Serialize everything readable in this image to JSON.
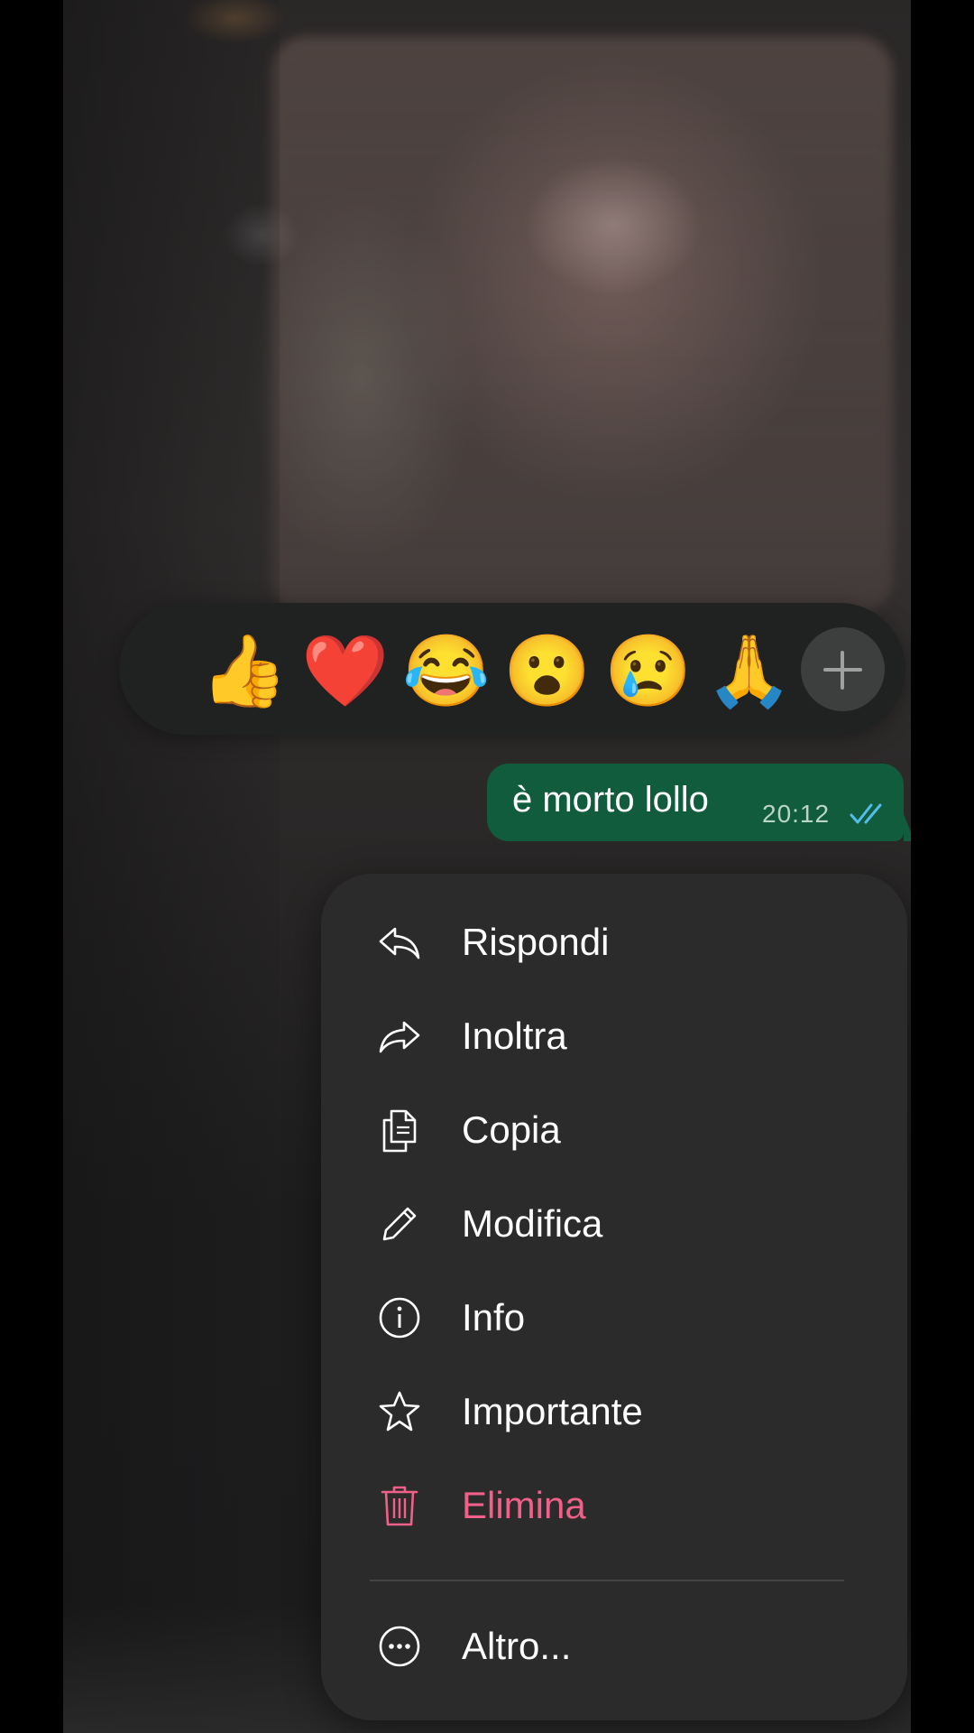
{
  "reactions": {
    "emojis": [
      "👍",
      "❤️",
      "😂",
      "😮",
      "😢",
      "🙏"
    ],
    "more_icon": "plus-icon"
  },
  "message": {
    "text": "è morto lollo",
    "time": "20:12",
    "status_icon": "double-check-icon",
    "bubble_color": "#105c3d",
    "tick_color": "#53bdeb"
  },
  "menu": {
    "items": [
      {
        "label": "Rispondi",
        "icon": "reply-icon"
      },
      {
        "label": "Inoltra",
        "icon": "forward-icon"
      },
      {
        "label": "Copia",
        "icon": "copy-icon"
      },
      {
        "label": "Modifica",
        "icon": "pencil-icon"
      },
      {
        "label": "Info",
        "icon": "info-icon"
      },
      {
        "label": "Importante",
        "icon": "star-icon"
      },
      {
        "label": "Elimina",
        "icon": "trash-icon",
        "color": "#f06088"
      }
    ],
    "more": {
      "label": "Altro...",
      "icon": "more-icon"
    }
  }
}
